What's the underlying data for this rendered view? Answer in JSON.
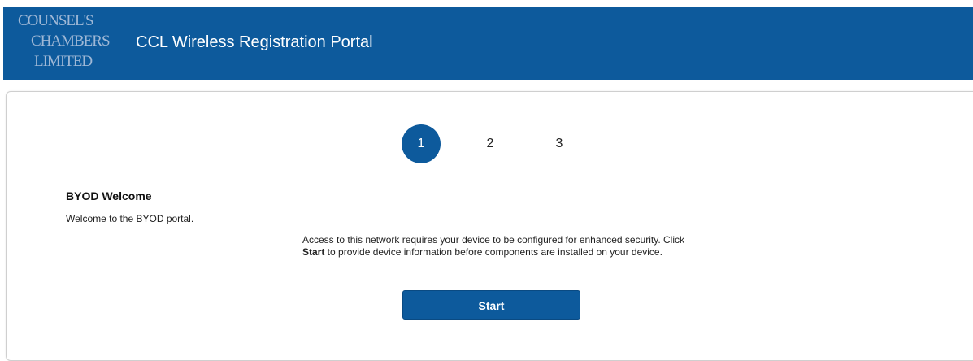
{
  "header": {
    "logo": {
      "line1": "COUNSEL'S",
      "line2": "CHAMBERS",
      "line3": "LIMITED"
    },
    "title": "CCL Wireless Registration Portal"
  },
  "steps": [
    {
      "label": "1",
      "active": true
    },
    {
      "label": "2",
      "active": false
    },
    {
      "label": "3",
      "active": false
    }
  ],
  "content": {
    "heading": "BYOD Welcome",
    "welcome": "Welcome to the BYOD portal.",
    "instructions_before": "Access to this network requires your device to be configured for enhanced security. Click ",
    "instructions_bold": "Start",
    "instructions_after": " to provide device information before components are installed on your device.",
    "start_label": "Start"
  },
  "colors": {
    "brand": "#0d5a9c",
    "logo_text": "#9fb8d6"
  }
}
